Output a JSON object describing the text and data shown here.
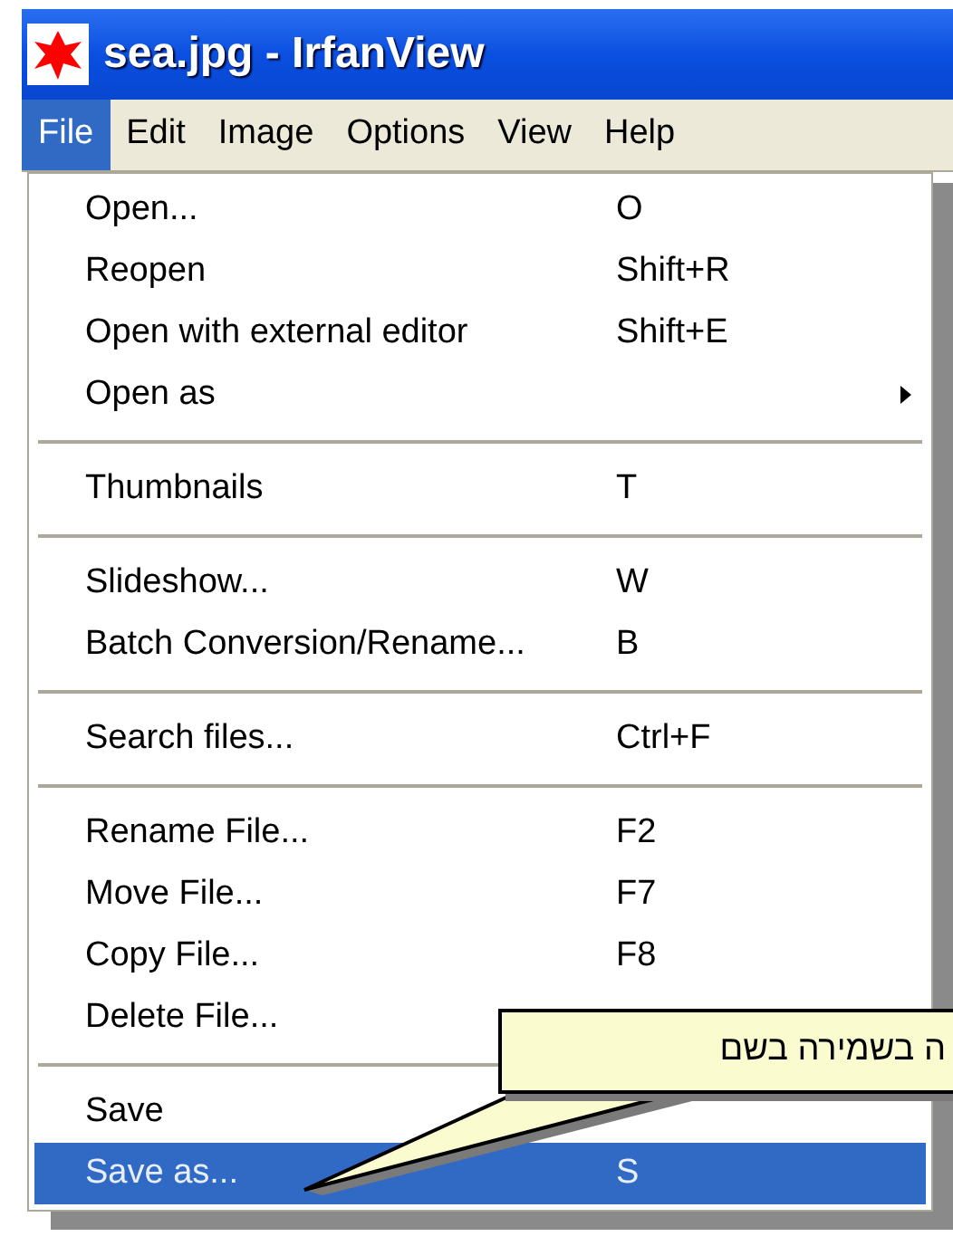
{
  "window": {
    "title": "sea.jpg - IrfanView"
  },
  "menubar": [
    {
      "label": "File",
      "selected": true
    },
    {
      "label": "Edit",
      "selected": false
    },
    {
      "label": "Image",
      "selected": false
    },
    {
      "label": "Options",
      "selected": false
    },
    {
      "label": "View",
      "selected": false
    },
    {
      "label": "Help",
      "selected": false
    }
  ],
  "menu": [
    {
      "kind": "item",
      "label": "Open...",
      "shortcut": "O",
      "submenu": false,
      "selected": false
    },
    {
      "kind": "item",
      "label": "Reopen",
      "shortcut": "Shift+R",
      "submenu": false,
      "selected": false
    },
    {
      "kind": "item",
      "label": "Open with external editor",
      "shortcut": "Shift+E",
      "submenu": false,
      "selected": false
    },
    {
      "kind": "item",
      "label": "Open as",
      "submenu": true,
      "selected": false
    },
    {
      "kind": "separator"
    },
    {
      "kind": "item",
      "label": "Thumbnails",
      "shortcut": "T",
      "submenu": false,
      "selected": false
    },
    {
      "kind": "separator"
    },
    {
      "kind": "item",
      "label": "Slideshow...",
      "shortcut": "W",
      "submenu": false,
      "selected": false
    },
    {
      "kind": "item",
      "label": "Batch Conversion/Rename...",
      "shortcut": "B",
      "submenu": false,
      "selected": false
    },
    {
      "kind": "separator"
    },
    {
      "kind": "item",
      "label": "Search files...",
      "shortcut": "Ctrl+F",
      "submenu": false,
      "selected": false
    },
    {
      "kind": "separator"
    },
    {
      "kind": "item",
      "label": "Rename File...",
      "shortcut": "F2",
      "submenu": false,
      "selected": false
    },
    {
      "kind": "item",
      "label": "Move File...",
      "shortcut": "F7",
      "submenu": false,
      "selected": false
    },
    {
      "kind": "item",
      "label": "Copy File...",
      "shortcut": "F8",
      "submenu": false,
      "selected": false
    },
    {
      "kind": "item",
      "label": "Delete File...",
      "submenu": false,
      "selected": false
    },
    {
      "kind": "separator"
    },
    {
      "kind": "item",
      "label": "Save",
      "submenu": false,
      "selected": false
    },
    {
      "kind": "item",
      "label": "Save as...",
      "shortcut": "S",
      "submenu": false,
      "selected": true
    }
  ],
  "callout": {
    "text": "ה בשמירה בשם"
  }
}
